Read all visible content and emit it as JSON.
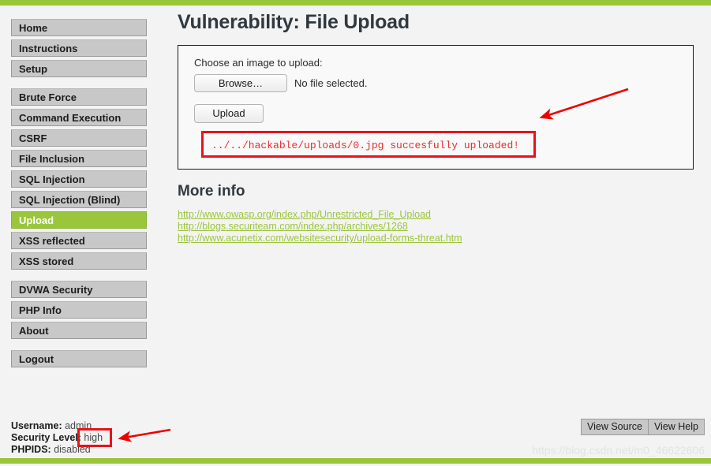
{
  "theme": {
    "accent_green": "#9ac63b",
    "annotation_red": "#e8131a",
    "message_red": "#ee2b2b",
    "nav_grey": "#c8c8c8",
    "page_bg": "#f3f3f3"
  },
  "sidebar": {
    "groups": [
      {
        "items": [
          {
            "label": "Home",
            "active": false
          },
          {
            "label": "Instructions",
            "active": false
          },
          {
            "label": "Setup",
            "active": false
          }
        ]
      },
      {
        "items": [
          {
            "label": "Brute Force",
            "active": false
          },
          {
            "label": "Command Execution",
            "active": false
          },
          {
            "label": "CSRF",
            "active": false
          },
          {
            "label": "File Inclusion",
            "active": false
          },
          {
            "label": "SQL Injection",
            "active": false
          },
          {
            "label": "SQL Injection (Blind)",
            "active": false
          },
          {
            "label": "Upload",
            "active": true
          },
          {
            "label": "XSS reflected",
            "active": false
          },
          {
            "label": "XSS stored",
            "active": false
          }
        ]
      },
      {
        "items": [
          {
            "label": "DVWA Security",
            "active": false
          },
          {
            "label": "PHP Info",
            "active": false
          },
          {
            "label": "About",
            "active": false
          }
        ]
      },
      {
        "items": [
          {
            "label": "Logout",
            "active": false
          }
        ]
      }
    ]
  },
  "main": {
    "page_title": "Vulnerability: File Upload",
    "upload_form": {
      "choose_label": "Choose an image to upload:",
      "browse_button": "Browse…",
      "file_status": "No file selected.",
      "upload_button": "Upload",
      "result_message": "../../hackable/uploads/0.jpg succesfully uploaded!"
    },
    "more_info": {
      "heading": "More info",
      "links": [
        "http://www.owasp.org/index.php/Unrestricted_File_Upload",
        "http://blogs.securiteam.com/index.php/archives/1268",
        "http://www.acunetix.com/websitesecurity/upload-forms-threat.htm"
      ]
    }
  },
  "footer": {
    "username_label": "Username:",
    "username_value": "admin",
    "security_level_label": "Security Level:",
    "security_level_value": "high",
    "phpids_label": "PHPIDS:",
    "phpids_value": "disabled",
    "view_source_button": "View Source",
    "view_help_button": "View Help",
    "watermark": "https://blog.csdn.net/m0_46622606"
  }
}
